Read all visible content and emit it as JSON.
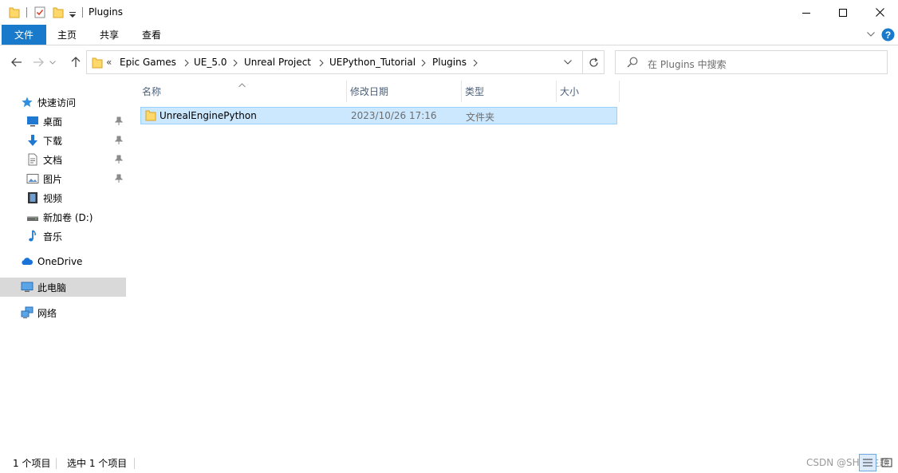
{
  "window": {
    "title": "Plugins",
    "controls": {
      "minimize": "minimize-icon",
      "maximize": "maximize-icon",
      "close": "close-icon"
    }
  },
  "ribbon": {
    "tabs": [
      {
        "label": "文件",
        "active": true
      },
      {
        "label": "主页"
      },
      {
        "label": "共享"
      },
      {
        "label": "查看"
      }
    ],
    "accent_color": "#1979ca"
  },
  "address": {
    "overflow": "«",
    "crumbs": [
      "Epic Games",
      "UE_5.0",
      "Unreal Project",
      "UEPython_Tutorial",
      "Plugins"
    ]
  },
  "search": {
    "placeholder": "在 Plugins 中搜索"
  },
  "sidebar": {
    "items": [
      {
        "label": "快速访问",
        "icon": "star-icon"
      },
      {
        "label": "桌面",
        "icon": "desktop-icon",
        "pinned": true
      },
      {
        "label": "下载",
        "icon": "download-icon",
        "pinned": true
      },
      {
        "label": "文档",
        "icon": "document-icon",
        "pinned": true
      },
      {
        "label": "图片",
        "icon": "picture-icon",
        "pinned": true
      },
      {
        "label": "视频",
        "icon": "video-icon"
      },
      {
        "label": "新加卷 (D:)",
        "icon": "drive-icon"
      },
      {
        "label": "音乐",
        "icon": "music-icon"
      },
      {
        "label": "OneDrive",
        "icon": "cloud-icon"
      },
      {
        "label": "此电脑",
        "icon": "computer-icon",
        "selected": true
      },
      {
        "label": "网络",
        "icon": "network-icon"
      }
    ]
  },
  "columns": [
    "名称",
    "修改日期",
    "类型",
    "大小"
  ],
  "files": [
    {
      "name": "UnrealEnginePython",
      "modified": "2023/10/26 17:16",
      "type": "文件夹",
      "size": "",
      "selected": true
    }
  ],
  "status": {
    "count": "1 个项目",
    "selected": "选中 1 个项目"
  },
  "watermark": "CSDN @SHOJ主题"
}
